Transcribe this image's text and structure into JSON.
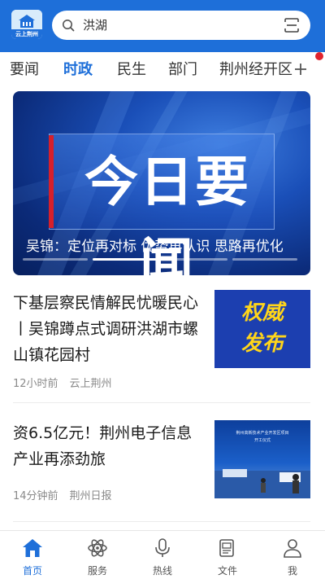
{
  "header": {
    "logo_text": "云上荆州",
    "search_text": "洪湖",
    "colors": {
      "brand": "#1e6fd9"
    }
  },
  "tabs": [
    {
      "label": "要闻",
      "active": false
    },
    {
      "label": "时政",
      "active": true
    },
    {
      "label": "民生",
      "active": false
    },
    {
      "label": "部门",
      "active": false
    },
    {
      "label": "荆州经开区",
      "active": false
    }
  ],
  "tabs_add_label": "+",
  "banner": {
    "title": "今日要闻",
    "caption": "吴锦：定位再对标 优势再认识 思路再优化",
    "slide_count": 4,
    "active_slide": 2
  },
  "news": [
    {
      "title": "下基层察民情解民忧暖民心丨吴锦蹲点式调研洪湖市螺山镇花园村",
      "time": "12小时前",
      "source": "云上荆州",
      "thumb_text": [
        "权威",
        "发布"
      ]
    },
    {
      "title": "资6.5亿元！荆州电子信息产业再添劲旅",
      "time": "14分钟前",
      "source": "荆州日报",
      "thumb_text": [
        "荆州高新技术产业开发区项目",
        "开工仪式"
      ]
    }
  ],
  "bottom_nav": [
    {
      "label": "首页",
      "icon": "home-icon",
      "active": true
    },
    {
      "label": "服务",
      "icon": "atom-icon",
      "active": false
    },
    {
      "label": "热线",
      "icon": "microphone-icon",
      "active": false
    },
    {
      "label": "文件",
      "icon": "document-icon",
      "active": false
    },
    {
      "label": "我",
      "icon": "user-icon",
      "active": false
    }
  ]
}
